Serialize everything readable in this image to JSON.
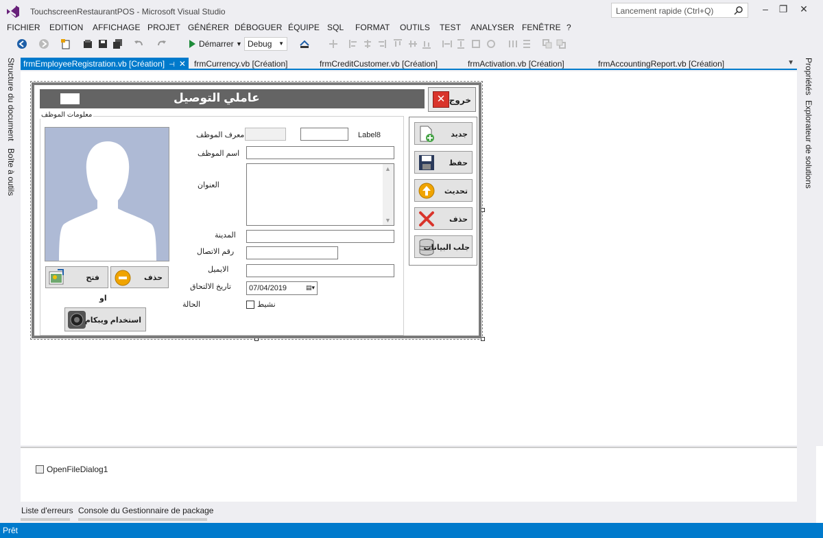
{
  "window": {
    "title": "TouchscreenRestaurantPOS - Microsoft Visual Studio",
    "quick_launch_placeholder": "Lancement rapide (Ctrl+Q)"
  },
  "menu": [
    "FICHIER",
    "EDITION",
    "AFFICHAGE",
    "PROJET",
    "GÉNÉRER",
    "DÉBOGUER",
    "ÉQUIPE",
    "SQL",
    "FORMAT",
    "OUTILS",
    "TEST",
    "ANALYSER",
    "FENÊTRE",
    "?"
  ],
  "toolbar": {
    "start_label": "Démarrer",
    "config_value": "Debug"
  },
  "left_panel": {
    "document_outline": "Structure du document",
    "toolbox": "Boîte à outils"
  },
  "right_panel": {
    "properties": "Propriétés",
    "solution_explorer": "Explorateur de solutions"
  },
  "doc_tabs": [
    "frmEmployeeRegistration.vb [Création]",
    "frmCurrency.vb [Création]",
    "frmCreditCustomer.vb [Création]",
    "frmActivation.vb [Création]",
    "frmAccountingReport.vb [Création]"
  ],
  "form": {
    "header_title": "عاملي التوصيل",
    "exit_label": "خروج",
    "group_title": "معلومات الموظف",
    "labels": {
      "employee_id": "معرف الموظف",
      "label8": "Label8",
      "employee_name": "اسم الموظف",
      "address": "العنوان",
      "city": "المدينة",
      "contact": "رقم الاتصال",
      "email": "الايميل",
      "joining_date": "تاريخ الالتحاق",
      "status": "الحالة",
      "active": "نشيط",
      "or": "او"
    },
    "date_value": "07/04/2019",
    "photo_buttons": {
      "delete": "حذف",
      "open": "فتح",
      "webcam": "استخدام ويبكام"
    },
    "side_buttons": [
      "جديد",
      "حفظ",
      "تحديث",
      "حذف",
      "جلب البيانات"
    ]
  },
  "component_tray": [
    "OpenFileDialog1"
  ],
  "bottom_tabs": [
    "Liste d'erreurs",
    "Console du Gestionnaire de package"
  ],
  "status": "Prêt",
  "colors": {
    "accent": "#007acc",
    "header_bar": "#646464",
    "photo_bg": "#aebad5"
  }
}
